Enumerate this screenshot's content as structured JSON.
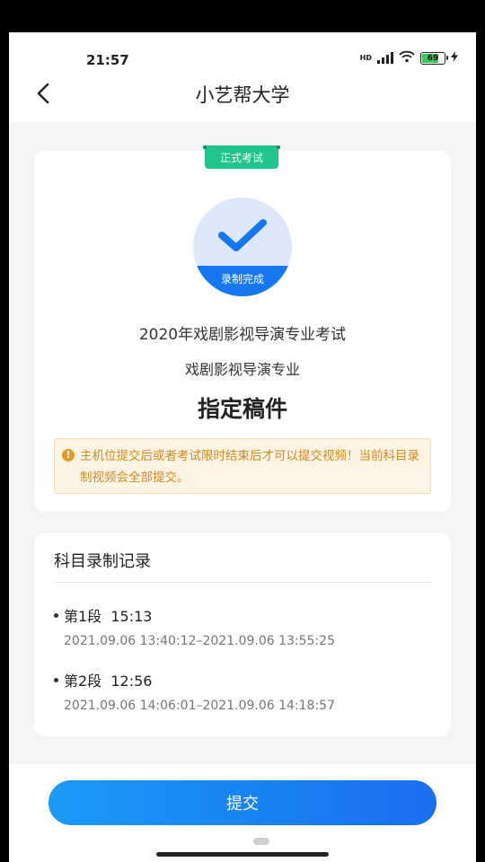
{
  "status": {
    "time": "21:57",
    "network": "HD",
    "battery": "69"
  },
  "nav": {
    "title": "小艺帮大学"
  },
  "exam": {
    "tag": "正式考试",
    "badge_label": "录制完成",
    "name": "2020年戏剧影视导演专业考试",
    "major": "戏剧影视导演专业",
    "subject": "指定稿件",
    "notice": "主机位提交后或者考试限时结束后才可以提交视频！当前科目录制视频会全部提交。"
  },
  "records": {
    "title": "科目录制记录",
    "segments": [
      {
        "label": "第1段  15:13",
        "range": "2021.09.06 13:40:12–2021.09.06 13:55:25"
      },
      {
        "label": "第2段  12:56",
        "range": "2021.09.06 14:06:01–2021.09.06 14:18:57"
      }
    ]
  },
  "actions": {
    "submit_label": "提交"
  },
  "colors": {
    "primary": "#1677f3",
    "tag_green": "#21c48b",
    "warning": "#e49a23"
  }
}
